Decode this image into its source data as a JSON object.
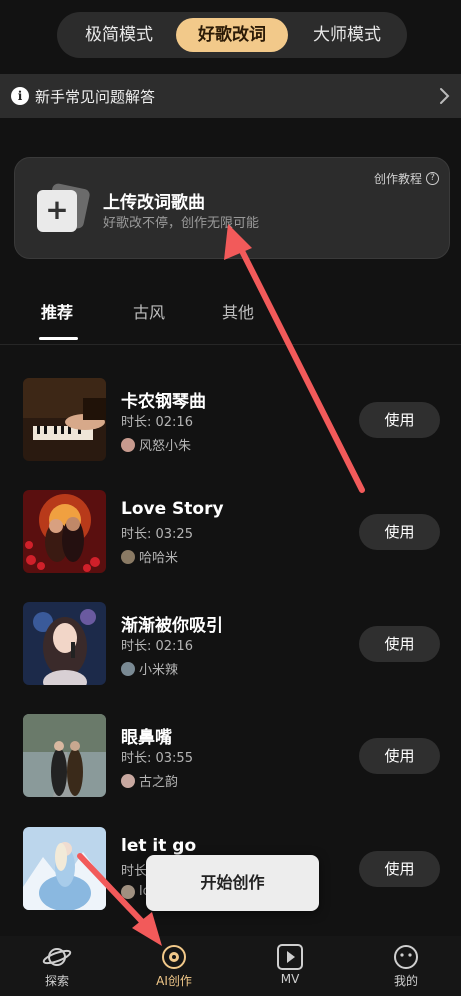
{
  "modes": [
    "极简模式",
    "好歌改词",
    "大师模式"
  ],
  "faq": {
    "label": "新手常见问题解答"
  },
  "upload": {
    "title": "上传改词歌曲",
    "subtitle": "好歌改不停，创作无限可能",
    "tutorial": "创作教程"
  },
  "tabs": [
    "推荐",
    "古风",
    "其他"
  ],
  "songs": [
    {
      "title": "卡农钢琴曲",
      "duration": "时长:   02:16",
      "author": "风怒小朱",
      "use": "使用"
    },
    {
      "title": "Love Story",
      "duration": "时长:   03:25",
      "author": "哈哈米",
      "use": "使用"
    },
    {
      "title": "渐渐被你吸引",
      "duration": "时长:   02:16",
      "author": "小米辣",
      "use": "使用"
    },
    {
      "title": "眼鼻嘴",
      "duration": "时长:   03:55",
      "author": "古之韵",
      "use": "使用"
    },
    {
      "title": "let it go",
      "duration": "时长:   03:29",
      "author": "lopas",
      "use": "使用"
    }
  ],
  "start_button": "开始创作",
  "nav": [
    "探索",
    "AI创作",
    "MV",
    "我的"
  ],
  "colors": {
    "accent": "#f2c98a",
    "annotation_arrow": "#f25a5a"
  }
}
